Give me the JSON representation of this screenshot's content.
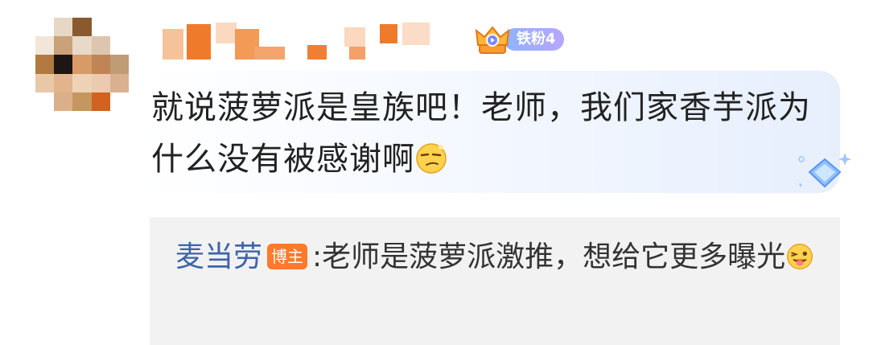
{
  "comment": {
    "fan_badge_label": "铁粉4",
    "text": "就说菠萝派是皇族吧！老师，我们家香芋派为什么没有被感谢啊",
    "emoji_icon": "smirk-face-emoji"
  },
  "reply": {
    "author": "麦当劳",
    "author_badge": "博主",
    "text": ":老师是菠萝派激推，想给它更多曝光",
    "emoji_icon": "tongue-wink-face-emoji"
  },
  "colors": {
    "author_link": "#3e64a8",
    "badge_orange": "#ff7a2a",
    "fan_badge": "#9fb0ff"
  }
}
